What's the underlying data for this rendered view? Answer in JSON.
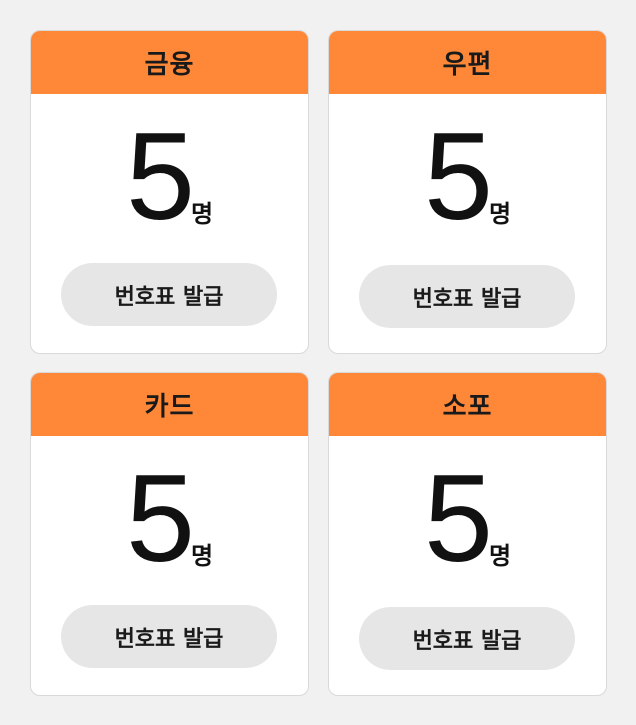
{
  "counters": [
    {
      "title": "금융",
      "count": "5",
      "unit": "명",
      "button_label": "번호표 발급"
    },
    {
      "title": "우편",
      "count": "5",
      "unit": "명",
      "button_label": "번호표 발급"
    },
    {
      "title": "카드",
      "count": "5",
      "unit": "명",
      "button_label": "번호표 발급"
    },
    {
      "title": "소포",
      "count": "5",
      "unit": "명",
      "button_label": "번호표 발급"
    }
  ],
  "colors": {
    "header": "#ff8838",
    "background": "#f1f1f1",
    "card": "#ffffff",
    "button": "#e6e6e6"
  }
}
